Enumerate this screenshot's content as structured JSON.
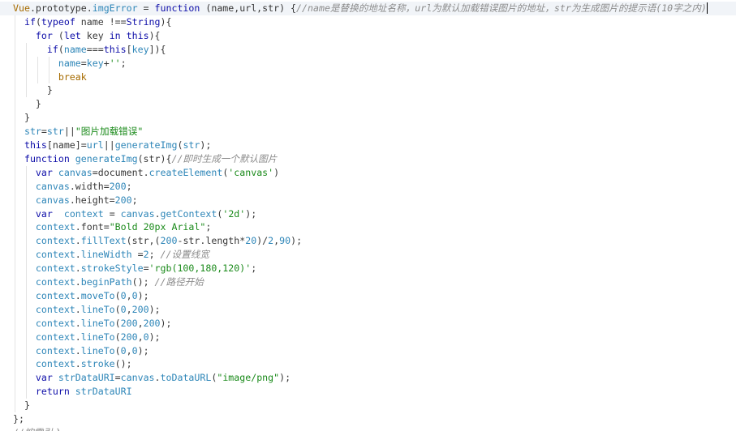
{
  "editor": {
    "colors": {
      "keyword": "#0d0da8",
      "property": "#2e86b8",
      "string": "#1a8a1a",
      "comment": "#8c8c8c",
      "plain": "#383838",
      "break_keyword": "#a66b00"
    },
    "lines": [
      {
        "tokens": [
          {
            "t": "Vue",
            "c": "t-kwo"
          },
          {
            "t": ".prototype.",
            "c": "t-pl"
          },
          {
            "t": "imgError",
            "c": "t-prop"
          },
          {
            "t": " = ",
            "c": "t-pl"
          },
          {
            "t": "function",
            "c": "t-kw"
          },
          {
            "t": " (name,url,str) {",
            "c": "t-pl"
          },
          {
            "t": "//name是替换的地址名称，url为默认加载错误图片的地址，str为生成图片的提示语(10字之内)",
            "c": "t-cm"
          }
        ]
      },
      {
        "tokens": [
          {
            "t": "  ",
            "c": "t-pl"
          },
          {
            "t": "if",
            "c": "t-kw"
          },
          {
            "t": "(",
            "c": "t-pl"
          },
          {
            "t": "typeof",
            "c": "t-kw"
          },
          {
            "t": " name !==",
            "c": "t-pl"
          },
          {
            "t": "String",
            "c": "t-kw"
          },
          {
            "t": "){",
            "c": "t-pl"
          }
        ]
      },
      {
        "tokens": [
          {
            "t": "    ",
            "c": "t-pl"
          },
          {
            "t": "for",
            "c": "t-kw"
          },
          {
            "t": " (",
            "c": "t-pl"
          },
          {
            "t": "let",
            "c": "t-kw"
          },
          {
            "t": " key ",
            "c": "t-pl"
          },
          {
            "t": "in",
            "c": "t-kw"
          },
          {
            "t": " ",
            "c": "t-pl"
          },
          {
            "t": "this",
            "c": "t-kw"
          },
          {
            "t": "){",
            "c": "t-pl"
          }
        ]
      },
      {
        "tokens": [
          {
            "t": "      ",
            "c": "t-pl"
          },
          {
            "t": "if",
            "c": "t-kw"
          },
          {
            "t": "(",
            "c": "t-pl"
          },
          {
            "t": "name",
            "c": "t-prop"
          },
          {
            "t": "===",
            "c": "t-pl"
          },
          {
            "t": "this",
            "c": "t-kw"
          },
          {
            "t": "[",
            "c": "t-pl"
          },
          {
            "t": "key",
            "c": "t-prop"
          },
          {
            "t": "]){",
            "c": "t-pl"
          }
        ]
      },
      {
        "tokens": [
          {
            "t": "        ",
            "c": "t-pl"
          },
          {
            "t": "name",
            "c": "t-prop"
          },
          {
            "t": "=",
            "c": "t-pl"
          },
          {
            "t": "key",
            "c": "t-prop"
          },
          {
            "t": "+",
            "c": "t-pl"
          },
          {
            "t": "''",
            "c": "t-str"
          },
          {
            "t": ";",
            "c": "t-pl"
          }
        ]
      },
      {
        "tokens": [
          {
            "t": "        ",
            "c": "t-pl"
          },
          {
            "t": "break",
            "c": "t-kwo"
          }
        ]
      },
      {
        "tokens": [
          {
            "t": "      }",
            "c": "t-pl"
          }
        ]
      },
      {
        "tokens": [
          {
            "t": "    }",
            "c": "t-pl"
          }
        ]
      },
      {
        "tokens": [
          {
            "t": "  }",
            "c": "t-pl"
          }
        ]
      },
      {
        "tokens": [
          {
            "t": "  ",
            "c": "t-pl"
          },
          {
            "t": "str",
            "c": "t-prop"
          },
          {
            "t": "=",
            "c": "t-pl"
          },
          {
            "t": "str",
            "c": "t-prop"
          },
          {
            "t": "||",
            "c": "t-pl"
          },
          {
            "t": "\"图片加载错误\"",
            "c": "t-str"
          }
        ]
      },
      {
        "tokens": [
          {
            "t": "  ",
            "c": "t-pl"
          },
          {
            "t": "this",
            "c": "t-kw"
          },
          {
            "t": "[name]=",
            "c": "t-pl"
          },
          {
            "t": "url",
            "c": "t-prop"
          },
          {
            "t": "||",
            "c": "t-pl"
          },
          {
            "t": "generateImg",
            "c": "t-prop"
          },
          {
            "t": "(",
            "c": "t-pl"
          },
          {
            "t": "str",
            "c": "t-prop"
          },
          {
            "t": ");",
            "c": "t-pl"
          }
        ]
      },
      {
        "tokens": [
          {
            "t": "  ",
            "c": "t-pl"
          },
          {
            "t": "function",
            "c": "t-kw"
          },
          {
            "t": " ",
            "c": "t-pl"
          },
          {
            "t": "generateImg",
            "c": "t-prop"
          },
          {
            "t": "(str){",
            "c": "t-pl"
          },
          {
            "t": "//即时生成一个默认图片",
            "c": "t-cm"
          }
        ]
      },
      {
        "tokens": [
          {
            "t": "    ",
            "c": "t-pl"
          },
          {
            "t": "var",
            "c": "t-kw"
          },
          {
            "t": " ",
            "c": "t-pl"
          },
          {
            "t": "canvas",
            "c": "t-prop"
          },
          {
            "t": "=document.",
            "c": "t-pl"
          },
          {
            "t": "createElement",
            "c": "t-prop"
          },
          {
            "t": "(",
            "c": "t-pl"
          },
          {
            "t": "'canvas'",
            "c": "t-str"
          },
          {
            "t": ")",
            "c": "t-pl"
          }
        ]
      },
      {
        "tokens": [
          {
            "t": "    ",
            "c": "t-pl"
          },
          {
            "t": "canvas",
            "c": "t-prop"
          },
          {
            "t": ".width=",
            "c": "t-pl"
          },
          {
            "t": "200",
            "c": "t-num"
          },
          {
            "t": ";",
            "c": "t-pl"
          }
        ]
      },
      {
        "tokens": [
          {
            "t": "    ",
            "c": "t-pl"
          },
          {
            "t": "canvas",
            "c": "t-prop"
          },
          {
            "t": ".height=",
            "c": "t-pl"
          },
          {
            "t": "200",
            "c": "t-num"
          },
          {
            "t": ";",
            "c": "t-pl"
          }
        ]
      },
      {
        "tokens": [
          {
            "t": "    ",
            "c": "t-pl"
          },
          {
            "t": "var",
            "c": "t-kw"
          },
          {
            "t": "  ",
            "c": "t-pl"
          },
          {
            "t": "context",
            "c": "t-prop"
          },
          {
            "t": " = ",
            "c": "t-pl"
          },
          {
            "t": "canvas",
            "c": "t-prop"
          },
          {
            "t": ".",
            "c": "t-pl"
          },
          {
            "t": "getContext",
            "c": "t-prop"
          },
          {
            "t": "(",
            "c": "t-pl"
          },
          {
            "t": "'2d'",
            "c": "t-str"
          },
          {
            "t": ");",
            "c": "t-pl"
          }
        ]
      },
      {
        "tokens": [
          {
            "t": "    ",
            "c": "t-pl"
          },
          {
            "t": "context",
            "c": "t-prop"
          },
          {
            "t": ".font=",
            "c": "t-pl"
          },
          {
            "t": "\"Bold 20px Arial\"",
            "c": "t-str"
          },
          {
            "t": ";",
            "c": "t-pl"
          }
        ]
      },
      {
        "tokens": [
          {
            "t": "    ",
            "c": "t-pl"
          },
          {
            "t": "context",
            "c": "t-prop"
          },
          {
            "t": ".",
            "c": "t-pl"
          },
          {
            "t": "fillText",
            "c": "t-prop"
          },
          {
            "t": "(str,(",
            "c": "t-pl"
          },
          {
            "t": "200",
            "c": "t-num"
          },
          {
            "t": "-str.length*",
            "c": "t-pl"
          },
          {
            "t": "20",
            "c": "t-num"
          },
          {
            "t": ")/",
            "c": "t-pl"
          },
          {
            "t": "2",
            "c": "t-num"
          },
          {
            "t": ",",
            "c": "t-pl"
          },
          {
            "t": "90",
            "c": "t-num"
          },
          {
            "t": ");",
            "c": "t-pl"
          }
        ]
      },
      {
        "tokens": [
          {
            "t": "    ",
            "c": "t-pl"
          },
          {
            "t": "context",
            "c": "t-prop"
          },
          {
            "t": ".",
            "c": "t-pl"
          },
          {
            "t": "lineWidth",
            "c": "t-prop"
          },
          {
            "t": " =",
            "c": "t-pl"
          },
          {
            "t": "2",
            "c": "t-num"
          },
          {
            "t": "; ",
            "c": "t-pl"
          },
          {
            "t": "//设置线宽",
            "c": "t-cm"
          }
        ]
      },
      {
        "tokens": [
          {
            "t": "    ",
            "c": "t-pl"
          },
          {
            "t": "context",
            "c": "t-prop"
          },
          {
            "t": ".",
            "c": "t-pl"
          },
          {
            "t": "strokeStyle",
            "c": "t-prop"
          },
          {
            "t": "=",
            "c": "t-pl"
          },
          {
            "t": "'rgb(100,180,120)'",
            "c": "t-str"
          },
          {
            "t": ";",
            "c": "t-pl"
          }
        ]
      },
      {
        "tokens": [
          {
            "t": "    ",
            "c": "t-pl"
          },
          {
            "t": "context",
            "c": "t-prop"
          },
          {
            "t": ".",
            "c": "t-pl"
          },
          {
            "t": "beginPath",
            "c": "t-prop"
          },
          {
            "t": "(); ",
            "c": "t-pl"
          },
          {
            "t": "//路径开始",
            "c": "t-cm"
          }
        ]
      },
      {
        "tokens": [
          {
            "t": "    ",
            "c": "t-pl"
          },
          {
            "t": "context",
            "c": "t-prop"
          },
          {
            "t": ".",
            "c": "t-pl"
          },
          {
            "t": "moveTo",
            "c": "t-prop"
          },
          {
            "t": "(",
            "c": "t-pl"
          },
          {
            "t": "0",
            "c": "t-num"
          },
          {
            "t": ",",
            "c": "t-pl"
          },
          {
            "t": "0",
            "c": "t-num"
          },
          {
            "t": ");",
            "c": "t-pl"
          }
        ]
      },
      {
        "tokens": [
          {
            "t": "    ",
            "c": "t-pl"
          },
          {
            "t": "context",
            "c": "t-prop"
          },
          {
            "t": ".",
            "c": "t-pl"
          },
          {
            "t": "lineTo",
            "c": "t-prop"
          },
          {
            "t": "(",
            "c": "t-pl"
          },
          {
            "t": "0",
            "c": "t-num"
          },
          {
            "t": ",",
            "c": "t-pl"
          },
          {
            "t": "200",
            "c": "t-num"
          },
          {
            "t": ");",
            "c": "t-pl"
          }
        ]
      },
      {
        "tokens": [
          {
            "t": "    ",
            "c": "t-pl"
          },
          {
            "t": "context",
            "c": "t-prop"
          },
          {
            "t": ".",
            "c": "t-pl"
          },
          {
            "t": "lineTo",
            "c": "t-prop"
          },
          {
            "t": "(",
            "c": "t-pl"
          },
          {
            "t": "200",
            "c": "t-num"
          },
          {
            "t": ",",
            "c": "t-pl"
          },
          {
            "t": "200",
            "c": "t-num"
          },
          {
            "t": ");",
            "c": "t-pl"
          }
        ]
      },
      {
        "tokens": [
          {
            "t": "    ",
            "c": "t-pl"
          },
          {
            "t": "context",
            "c": "t-prop"
          },
          {
            "t": ".",
            "c": "t-pl"
          },
          {
            "t": "lineTo",
            "c": "t-prop"
          },
          {
            "t": "(",
            "c": "t-pl"
          },
          {
            "t": "200",
            "c": "t-num"
          },
          {
            "t": ",",
            "c": "t-pl"
          },
          {
            "t": "0",
            "c": "t-num"
          },
          {
            "t": ");",
            "c": "t-pl"
          }
        ]
      },
      {
        "tokens": [
          {
            "t": "    ",
            "c": "t-pl"
          },
          {
            "t": "context",
            "c": "t-prop"
          },
          {
            "t": ".",
            "c": "t-pl"
          },
          {
            "t": "lineTo",
            "c": "t-prop"
          },
          {
            "t": "(",
            "c": "t-pl"
          },
          {
            "t": "0",
            "c": "t-num"
          },
          {
            "t": ",",
            "c": "t-pl"
          },
          {
            "t": "0",
            "c": "t-num"
          },
          {
            "t": ");",
            "c": "t-pl"
          }
        ]
      },
      {
        "tokens": [
          {
            "t": "    ",
            "c": "t-pl"
          },
          {
            "t": "context",
            "c": "t-prop"
          },
          {
            "t": ".",
            "c": "t-pl"
          },
          {
            "t": "stroke",
            "c": "t-prop"
          },
          {
            "t": "();",
            "c": "t-pl"
          }
        ]
      },
      {
        "tokens": [
          {
            "t": "    ",
            "c": "t-pl"
          },
          {
            "t": "var",
            "c": "t-kw"
          },
          {
            "t": " ",
            "c": "t-pl"
          },
          {
            "t": "strDataURI",
            "c": "t-prop"
          },
          {
            "t": "=",
            "c": "t-pl"
          },
          {
            "t": "canvas",
            "c": "t-prop"
          },
          {
            "t": ".",
            "c": "t-pl"
          },
          {
            "t": "toDataURL",
            "c": "t-prop"
          },
          {
            "t": "(",
            "c": "t-pl"
          },
          {
            "t": "\"image/png\"",
            "c": "t-str"
          },
          {
            "t": ");",
            "c": "t-pl"
          }
        ]
      },
      {
        "tokens": [
          {
            "t": "    ",
            "c": "t-pl"
          },
          {
            "t": "return",
            "c": "t-kw"
          },
          {
            "t": " ",
            "c": "t-pl"
          },
          {
            "t": "strDataURI",
            "c": "t-prop"
          }
        ]
      },
      {
        "tokens": [
          {
            "t": "  }",
            "c": "t-pl"
          }
        ]
      },
      {
        "tokens": [
          {
            "t": "};",
            "c": "t-pl"
          }
        ]
      },
      {
        "tokens": [
          {
            "t": "//按需引入",
            "c": "t-cm"
          }
        ]
      }
    ]
  }
}
